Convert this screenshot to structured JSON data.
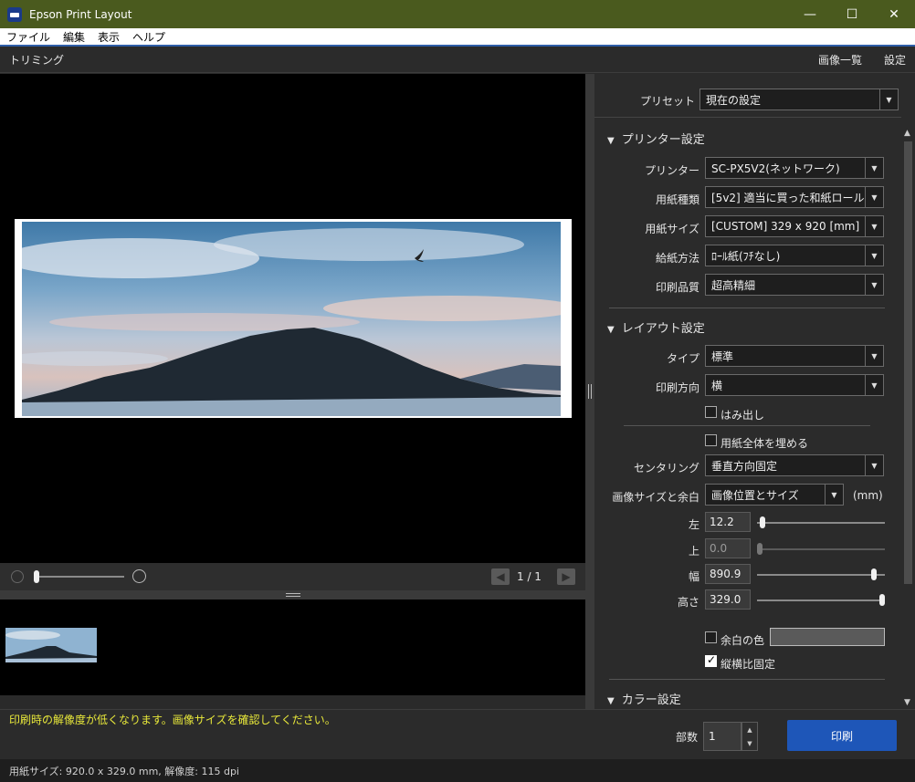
{
  "window": {
    "title": "Epson Print Layout",
    "min": "—",
    "max": "☐",
    "close": "✕"
  },
  "menu": [
    "ファイル",
    "編集",
    "表示",
    "ヘルプ"
  ],
  "toolbar": {
    "trim": "トリミング",
    "image_list": "画像一覧",
    "settings": "設定"
  },
  "preview": {
    "page_indicator": "1 / 1",
    "prev": "◀",
    "next": "▶"
  },
  "panel": {
    "preset_label": "プリセット",
    "preset_value": "現在の設定",
    "printer_section": "プリンター設定",
    "printer_label": "プリンター",
    "printer_value": "SC-PX5V2(ネットワーク)",
    "paper_type_label": "用紙種類",
    "paper_type_value": "[5v2] 適当に買った和紙ロール",
    "paper_size_label": "用紙サイズ",
    "paper_size_value": "[CUSTOM] 329 x 920 [mm]",
    "feed_label": "給紙方法",
    "feed_value": "ﾛｰﾙ紙(ﾌﾁなし)",
    "quality_label": "印刷品質",
    "quality_value": "超高精細",
    "layout_section": "レイアウト設定",
    "type_label": "タイプ",
    "type_value": "標準",
    "orientation_label": "印刷方向",
    "orientation_value": "横",
    "bleed_label": "はみ出し",
    "fill_label": "用紙全体を埋める",
    "centering_label": "センタリング",
    "centering_value": "垂直方向固定",
    "size_margin_label": "画像サイズと余白",
    "size_margin_value": "画像位置とサイズ",
    "unit": "(mm)",
    "left_label": "左",
    "left_value": "12.2",
    "left_slider": 0.02,
    "top_label": "上",
    "top_value": "0.0",
    "top_slider": 0.0,
    "width_label": "幅",
    "width_value": "890.9",
    "width_slider": 0.93,
    "height_label": "高さ",
    "height_value": "329.0",
    "height_slider": 1.0,
    "margin_color_label": "余白の色",
    "aspect_label": "縦横比固定",
    "color_section": "カラー設定"
  },
  "bottom": {
    "warning": "印刷時の解像度が低くなります。画像サイズを確認してください。",
    "copies_label": "部数",
    "copies_value": "1",
    "print_button": "印刷"
  },
  "status": "用紙サイズ: 920.0 x 329.0 mm,  解像度: 115 dpi"
}
